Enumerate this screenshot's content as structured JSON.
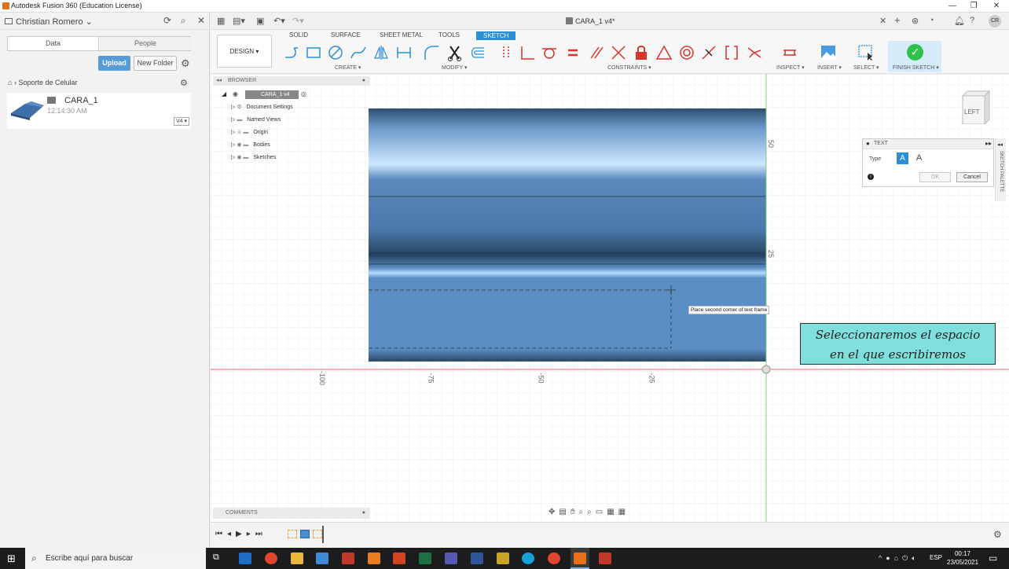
{
  "app_title": "Autodesk Fusion 360 (Education License)",
  "user": "Christian Romero",
  "panel_tabs": {
    "data": "Data",
    "people": "People"
  },
  "buttons": {
    "upload": "Upload",
    "new_folder": "New Folder"
  },
  "breadcrumb": "Soporte de Celular",
  "file": {
    "name": "CARA_1",
    "time": "12:14:30 AM",
    "version": "V4 ▾"
  },
  "doc_title": "CARA_1 v4*",
  "workspace": "DESIGN ▾",
  "ribbon_tabs": [
    "SOLID",
    "SURFACE",
    "SHEET METAL",
    "TOOLS",
    "SKETCH"
  ],
  "groups": {
    "create": "CREATE ▾",
    "modify": "MODIFY ▾",
    "constraints": "CONSTRAINTS ▾",
    "inspect": "INSPECT ▾",
    "insert": "INSERT ▾",
    "select": "SELECT ▾",
    "finish": "FINISH SKETCH ▾"
  },
  "browser": {
    "title": "BROWSER",
    "root": "CARA_1 v4",
    "items": [
      "Document Settings",
      "Named Views",
      "Origin",
      "Bodies",
      "Sketches"
    ]
  },
  "text_panel": {
    "title": "TEXT",
    "type_label": "Type",
    "ok": "OK",
    "cancel": "Cancel"
  },
  "palette_label": "SKETCH PALETTE",
  "viewcube": "LEFT",
  "tooltip": "Place second corner of text frame",
  "annotation": {
    "line1": "Seleccionaremos el espacio",
    "line2": "en el que escribiremos"
  },
  "ruler_h": [
    "-100",
    "-75",
    "-50",
    "-25"
  ],
  "ruler_v": [
    "50",
    "25"
  ],
  "comments": "COMMENTS",
  "taskbar": {
    "search": "Escribe aquí para buscar",
    "lang": "ESP",
    "time": "00:17",
    "date": "23/05/2021"
  },
  "colors": {
    "accent": "#2c8fd6",
    "body": "#5b8fc4",
    "annotation": "#7fdfdc",
    "finish": "#2ec24a"
  }
}
